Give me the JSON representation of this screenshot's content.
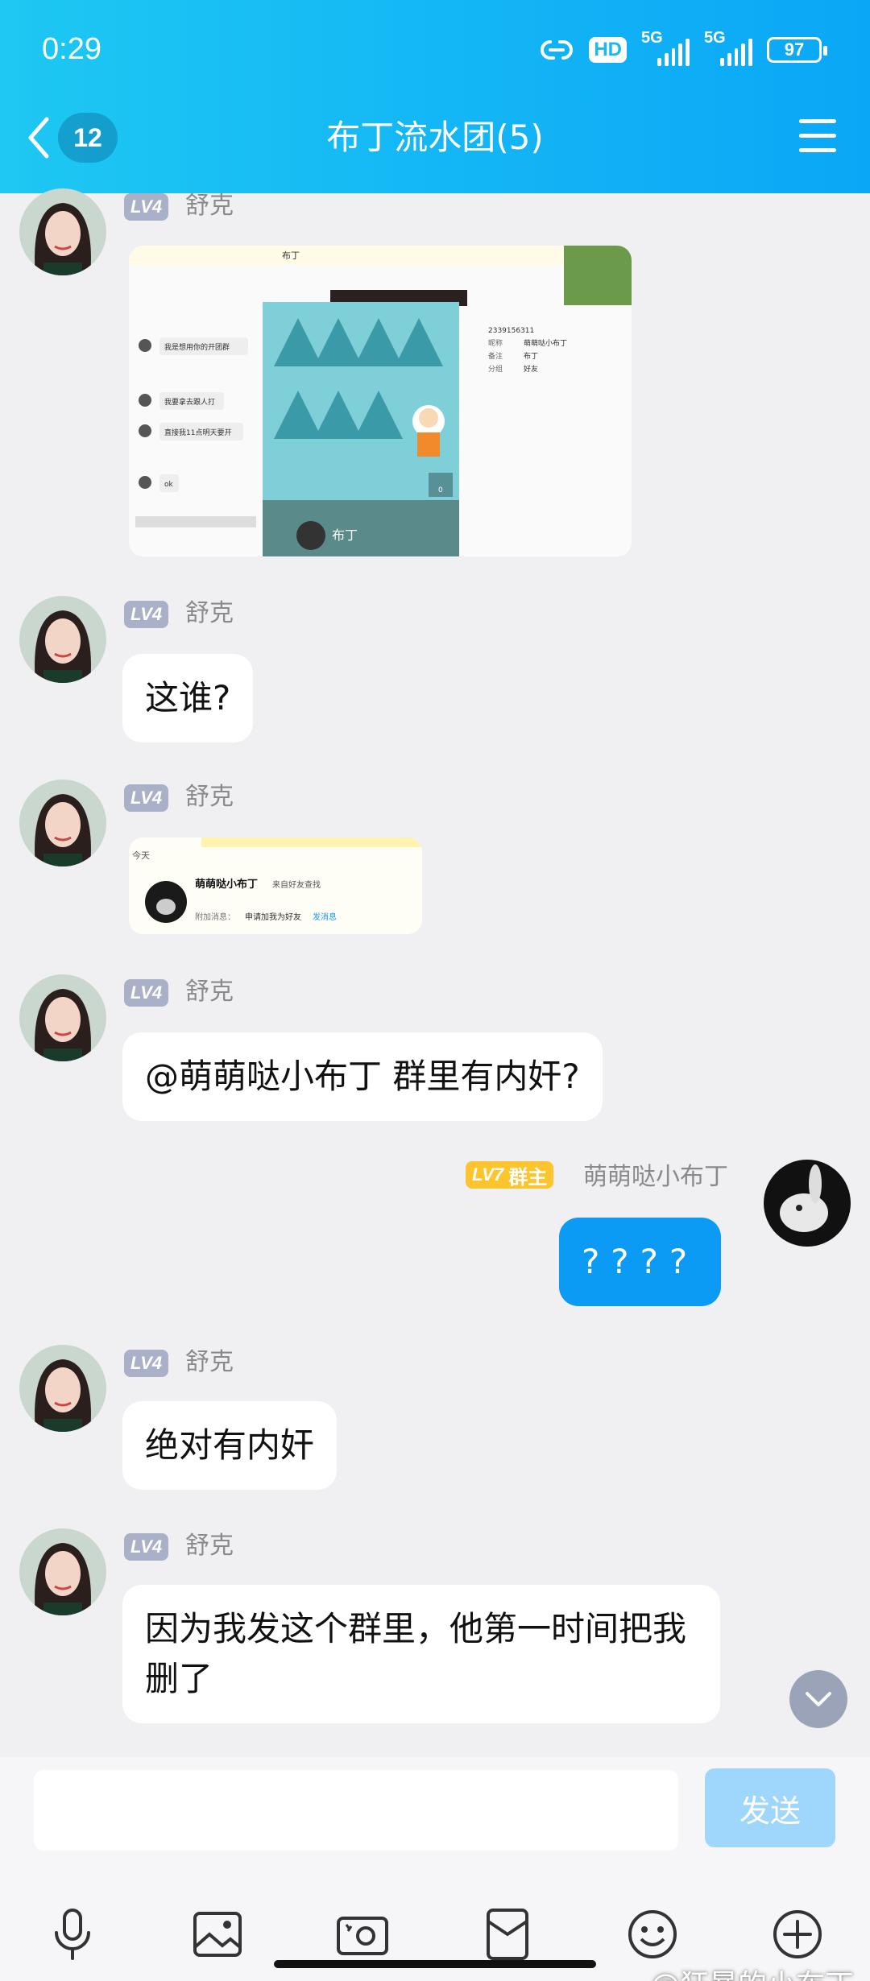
{
  "status_bar": {
    "time": "0:29",
    "hd": "HD",
    "net1": "5G",
    "net2": "5G",
    "battery": "97"
  },
  "header": {
    "unread_count": "12",
    "title": "布丁流水团(5)"
  },
  "messages": [
    {
      "sender": "舒克",
      "level": "LV4",
      "type": "image"
    },
    {
      "sender": "舒克",
      "level": "LV4",
      "text": "这谁?"
    },
    {
      "sender": "舒克",
      "level": "LV4",
      "type": "image"
    },
    {
      "sender": "舒克",
      "level": "LV4",
      "text": "@萌萌哒小布丁 群里有内奸?"
    },
    {
      "sender": "萌萌哒小布丁",
      "level": "LV7",
      "role": "群主",
      "text": "????"
    },
    {
      "sender": "舒克",
      "level": "LV4",
      "text": "绝对有内奸"
    },
    {
      "sender": "舒克",
      "level": "LV4",
      "text": "因为我发这个群里，他第一时间把我删了"
    }
  ],
  "screenshot1": {
    "window_title": "布丁",
    "chat_lines": [
      "我是想用你的开团群",
      "我要拿去跟人打",
      "直接我11点明天要开",
      "ok"
    ],
    "profile_name": "布丁",
    "info_labels": [
      "",
      "昵称",
      "备注",
      "分组"
    ],
    "info_values": [
      "2339156311",
      "萌萌哒小布丁",
      "布丁",
      "好友"
    ],
    "like_count": "0"
  },
  "screenshot2": {
    "date": "今天",
    "name": "萌萌哒小布丁",
    "source": "来自好友查找",
    "note_label": "附加消息：",
    "note": "申请加我为好友",
    "link": "发消息"
  },
  "input": {
    "placeholder": "",
    "send_label": "发送"
  },
  "watermark": "@狂暴的小布丁",
  "colors": {
    "header": "#14b7f5",
    "my_bubble": "#0b9bf4",
    "send_button": "#9fd6fb",
    "owner_badge": "#fdc52d",
    "level_badge": "#a9b0c8"
  }
}
